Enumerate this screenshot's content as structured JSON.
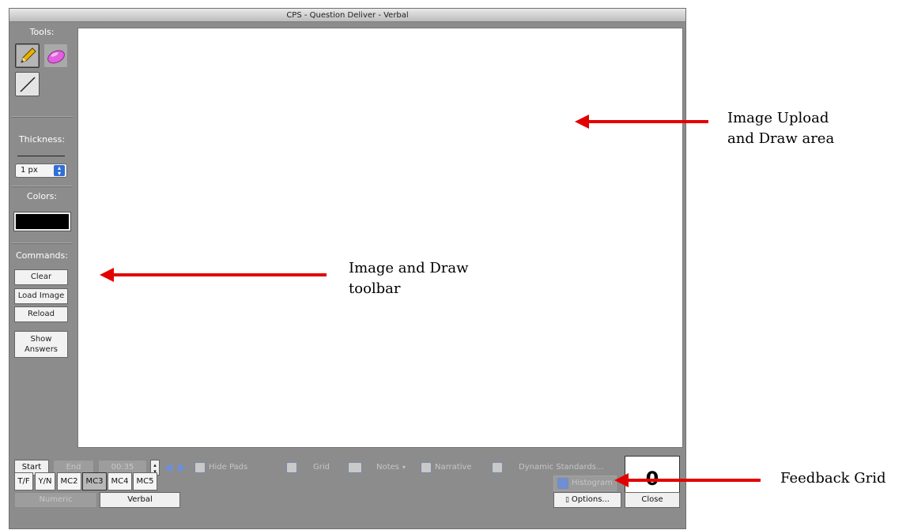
{
  "window": {
    "title": "CPS - Question Deliver - Verbal"
  },
  "toolbar": {
    "tools_label": "Tools:",
    "tools": [
      "pencil-icon",
      "eraser-icon",
      "line-icon"
    ],
    "thickness_label": "Thickness:",
    "thickness_value": "1 px",
    "colors_label": "Colors:",
    "selected_color": "#000000",
    "commands_label": "Commands:",
    "commands": [
      "Clear",
      "Load Image",
      "Reload"
    ],
    "show_answers_line1": "Show",
    "show_answers_line2": "Answers"
  },
  "controls": {
    "start": "Start",
    "end": "End",
    "timer": "00:35",
    "hide_pads": "Hide Pads",
    "grid": "Grid",
    "notes": "Notes",
    "narrative": "Narrative",
    "dynamic_standards": "Dynamic Standards...",
    "count": "0",
    "histogram": "Histogram",
    "options": "Options...",
    "close": "Close"
  },
  "question_types": [
    "T/F",
    "Y/N",
    "MC2",
    "MC3",
    "MC4",
    "MC5"
  ],
  "selected_question_type": "MC3",
  "answer_modes": [
    "Numeric",
    "Verbal"
  ],
  "selected_answer_mode": "Verbal",
  "annotations": {
    "draw_area_line1": "Image Upload",
    "draw_area_line2": "and Draw area",
    "toolbar_line1": "Image and Draw",
    "toolbar_line2": "toolbar",
    "feedback_grid": "Feedback Grid"
  },
  "colors": {
    "annotation_arrow": "#e30000",
    "window_background": "#8c8c8c"
  }
}
